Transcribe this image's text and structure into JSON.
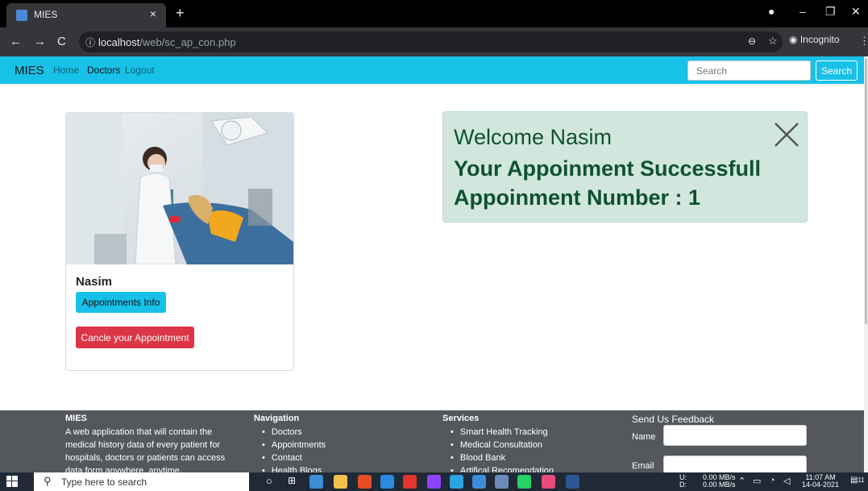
{
  "browser": {
    "tab_title": "MIES",
    "tab_close": "×",
    "new_tab": "+",
    "url_host": "localhost",
    "url_path": "/web/sc_ap_con.php",
    "incognito_label": "Incognito"
  },
  "navbar": {
    "brand": "MIES",
    "links": [
      "Home",
      "Doctors",
      "Logout"
    ],
    "search_placeholder": "Search",
    "search_button": "Search"
  },
  "card": {
    "name": "Nasim",
    "info_button": "Appointments Info",
    "cancel_button": "Cancle your Appointment"
  },
  "alert": {
    "welcome": "Welcome Nasim",
    "line1": "Your Appoinment Successfull",
    "line2": "Appoinment Number : 1"
  },
  "footer": {
    "about_title": "MIES",
    "about_text": "A web application that will contain the medical history data of every patient for hospitals, doctors or patients can access data form anywhere, anytime.",
    "nav_title": "Navigation",
    "nav_items": [
      "Doctors",
      "Appointments",
      "Contact",
      "Health Blogs"
    ],
    "services_title": "Services",
    "services_items": [
      "Smart Health Tracking",
      "Medical Consultation",
      "Blood Bank",
      "Artifical Recomendation"
    ],
    "feedback_title": "Send Us Feedback",
    "name_label": "Name",
    "email_label": "Email"
  },
  "taskbar": {
    "search_placeholder": "Type here to search",
    "net_up_label": "U:",
    "net_down_label": "D:",
    "net_up": "0.00 MB/s",
    "net_down": "0.00 MB/s",
    "time": "11:07 AM",
    "date": "14-04-2021",
    "notification_count": "11"
  },
  "colors": {
    "navbar": "#17c1e8",
    "alert_bg": "#d1e7dd",
    "alert_text": "#0f5132",
    "danger": "#dc3545",
    "footer": "#54585c"
  }
}
